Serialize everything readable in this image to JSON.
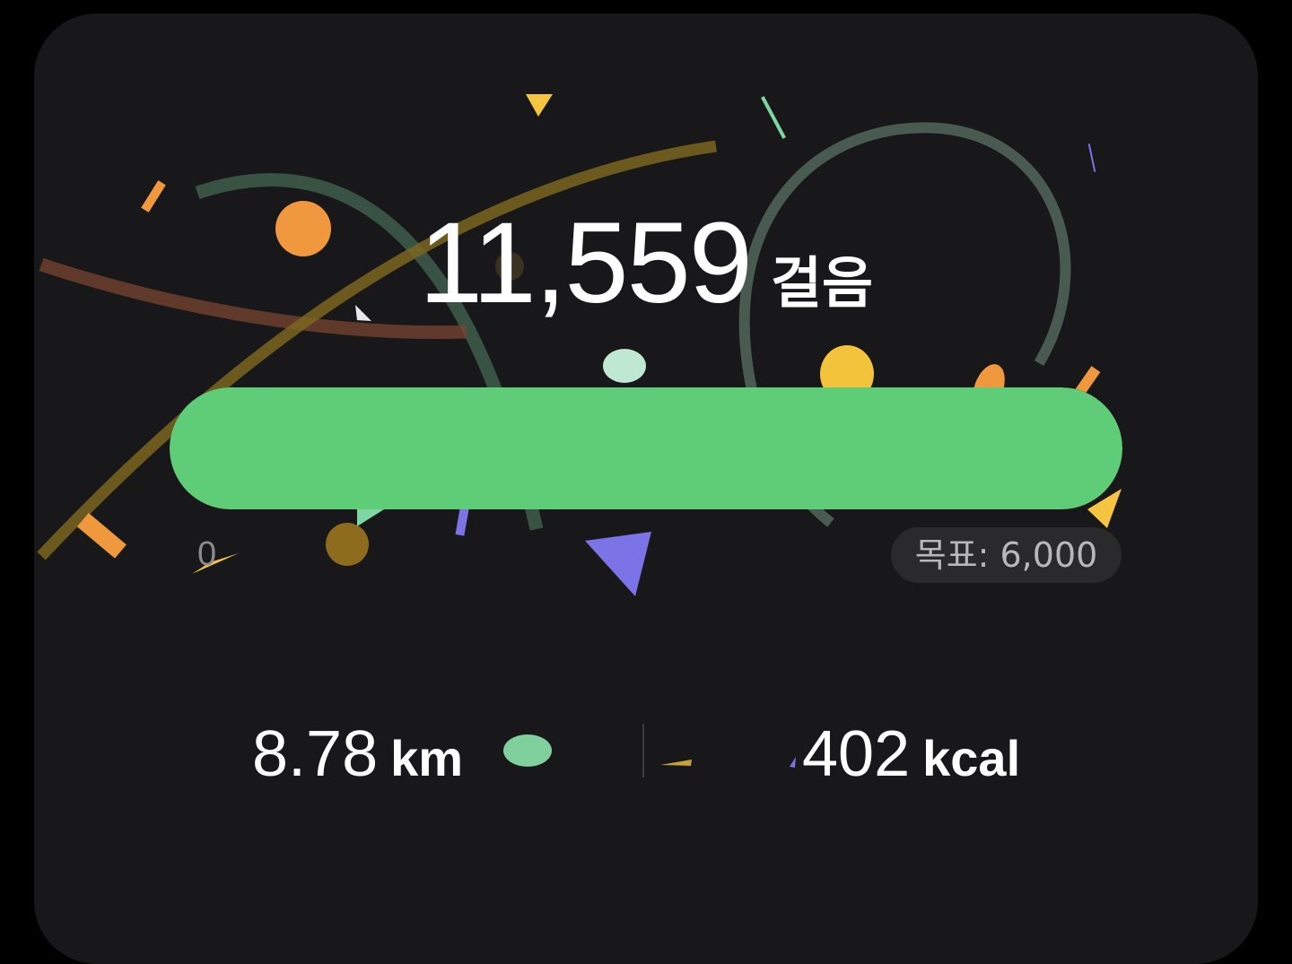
{
  "steps": {
    "count": "11,559",
    "unit": "걸음"
  },
  "progress": {
    "min_label": "0",
    "goal_label": "목표: 6,000",
    "current": 11559,
    "goal": 6000,
    "fill_fraction": 1.0
  },
  "stats": {
    "distance_value": "8.78",
    "distance_unit": "km",
    "calories_value": "402",
    "calories_unit": "kcal"
  },
  "colors": {
    "card_background": "#18181a",
    "progress_green": "#5fcd78",
    "confetti_orange": "#f0a040",
    "confetti_yellow": "#f5c542",
    "confetti_mint": "#7fd6a0",
    "confetti_purple": "#7b73e6",
    "confetti_olive": "#8a6a1e"
  }
}
